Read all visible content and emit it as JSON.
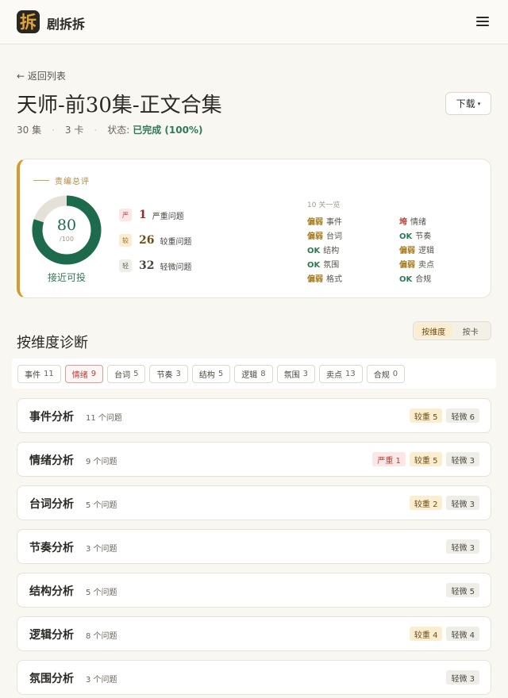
{
  "app": {
    "logo_char": "拆",
    "name": "剧拆拆"
  },
  "nav": {
    "back_label": "← 返回列表"
  },
  "project": {
    "title": "天师-前30集-正文合集",
    "episodes": "30 集",
    "cards": "3 卡",
    "status_label": "状态:",
    "status_value": "已完成 (100%)"
  },
  "download": {
    "label": "下载",
    "caret": "▾"
  },
  "summary": {
    "label": "责编总评",
    "score": "80",
    "score_max": "/100",
    "score_fraction": 0.8,
    "verdict": "接近可投",
    "severity": [
      {
        "badge": "严",
        "count": "1",
        "label": "严重问题",
        "level": "severe"
      },
      {
        "badge": "较",
        "count": "26",
        "label": "较重问题",
        "level": "major"
      },
      {
        "badge": "轻",
        "count": "32",
        "label": "轻微问题",
        "level": "minor"
      }
    ],
    "overview_title": "10 关一览",
    "overview": [
      {
        "status": "偏弱",
        "name": "事件",
        "kind": "weak"
      },
      {
        "status": "垮",
        "name": "情绪",
        "kind": "over"
      },
      {
        "status": "偏弱",
        "name": "台词",
        "kind": "weak"
      },
      {
        "status": "OK",
        "name": "节奏",
        "kind": "ok"
      },
      {
        "status": "OK",
        "name": "结构",
        "kind": "ok"
      },
      {
        "status": "偏弱",
        "name": "逻辑",
        "kind": "weak"
      },
      {
        "status": "OK",
        "name": "氛围",
        "kind": "ok"
      },
      {
        "status": "偏弱",
        "name": "卖点",
        "kind": "weak"
      },
      {
        "status": "偏弱",
        "name": "格式",
        "kind": "weak"
      },
      {
        "status": "OK",
        "name": "合规",
        "kind": "ok"
      }
    ]
  },
  "diagnosis": {
    "title": "按维度诊断",
    "toggle": {
      "by_dimension": "按维度",
      "by_card": "按卡"
    },
    "chips": [
      {
        "label": "事件",
        "count": "11"
      },
      {
        "label": "情绪",
        "count": "9",
        "active": true
      },
      {
        "label": "台词",
        "count": "5"
      },
      {
        "label": "节奏",
        "count": "3"
      },
      {
        "label": "结构",
        "count": "5"
      },
      {
        "label": "逻辑",
        "count": "8"
      },
      {
        "label": "氛围",
        "count": "3"
      },
      {
        "label": "卖点",
        "count": "13"
      },
      {
        "label": "合规",
        "count": "0"
      }
    ],
    "dimensions": [
      {
        "name": "事件分析",
        "count": "11 个问题",
        "tags": [
          {
            "text": "较重 5",
            "level": "major"
          },
          {
            "text": "轻微 6",
            "level": "minor"
          }
        ]
      },
      {
        "name": "情绪分析",
        "count": "9 个问题",
        "tags": [
          {
            "text": "严重 1",
            "level": "severe"
          },
          {
            "text": "较重 5",
            "level": "major"
          },
          {
            "text": "轻微 3",
            "level": "minor"
          }
        ]
      },
      {
        "name": "台词分析",
        "count": "5 个问题",
        "tags": [
          {
            "text": "较重 2",
            "level": "major"
          },
          {
            "text": "轻微 3",
            "level": "minor"
          }
        ]
      },
      {
        "name": "节奏分析",
        "count": "3 个问题",
        "tags": [
          {
            "text": "轻微 3",
            "level": "minor"
          }
        ]
      },
      {
        "name": "结构分析",
        "count": "5 个问题",
        "tags": [
          {
            "text": "轻微 5",
            "level": "minor"
          }
        ]
      },
      {
        "name": "逻辑分析",
        "count": "8 个问题",
        "tags": [
          {
            "text": "较重 4",
            "level": "major"
          },
          {
            "text": "轻微 4",
            "level": "minor"
          }
        ]
      },
      {
        "name": "氛围分析",
        "count": "3 个问题",
        "tags": [
          {
            "text": "轻微 3",
            "level": "minor"
          }
        ]
      }
    ]
  },
  "colors": {
    "accent_gold": "#d89a2e",
    "ok_green": "#2f7a56",
    "score_ring": "#1d6a4c",
    "ring_track": "#e4e1d8",
    "severe_red": "#b3403a"
  }
}
